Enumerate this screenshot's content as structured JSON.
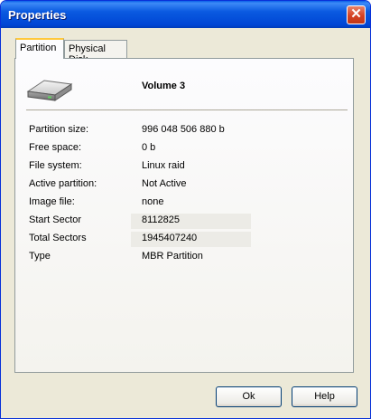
{
  "window": {
    "title": "Properties"
  },
  "tabs": [
    {
      "label": "Partition"
    },
    {
      "label": "Physical Disk"
    }
  ],
  "volume": {
    "name": "Volume 3"
  },
  "properties": [
    {
      "label": "Partition size:",
      "value": "996 048 506 880  b"
    },
    {
      "label": "Free space:",
      "value": "0  b"
    },
    {
      "label": "File system:",
      "value": "Linux raid"
    },
    {
      "label": "Active partition:",
      "value": "Not Active"
    },
    {
      "label": "Image file:",
      "value": "none"
    },
    {
      "label": "Start Sector",
      "value": "8112825"
    },
    {
      "label": "Total Sectors",
      "value": "1945407240"
    },
    {
      "label": "Type",
      "value": "MBR Partition"
    }
  ],
  "buttons": {
    "ok": "Ok",
    "help": "Help"
  },
  "icons": {
    "close": "close-icon",
    "drive": "hard-drive-icon"
  }
}
